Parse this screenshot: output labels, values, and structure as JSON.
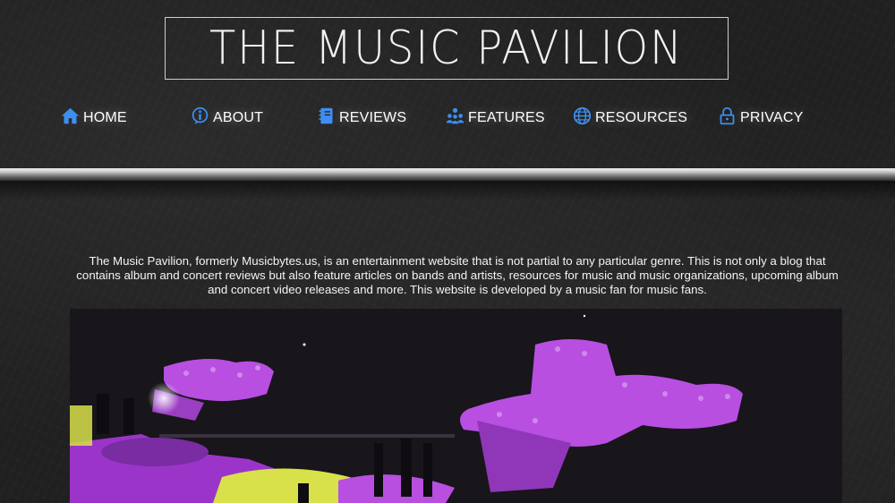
{
  "site": {
    "logo_text": "THE MUSIC PAVILION"
  },
  "nav": {
    "items": [
      {
        "label": "HOME",
        "icon": "home-icon"
      },
      {
        "label": "ABOUT",
        "icon": "info-icon"
      },
      {
        "label": "REVIEWS",
        "icon": "notebook-icon"
      },
      {
        "label": "FEATURES",
        "icon": "users-icon"
      },
      {
        "label": "RESOURCES",
        "icon": "globe-icon"
      },
      {
        "label": "PRIVACY",
        "icon": "lock-icon"
      }
    ]
  },
  "intro": {
    "text": "The Music Pavilion, formerly Musicbytes.us, is an entertainment website that is not partial to any particular genre. This is not only a blog that contains album and concert reviews but also feature articles on bands and artists, resources for music and music organizations, upcoming album and concert video releases and more. This website is developed by a music fan for music fans."
  },
  "colors": {
    "accent": "#3e8ef0",
    "crowd": "#b84fe0",
    "stage": "#d8e04a"
  }
}
